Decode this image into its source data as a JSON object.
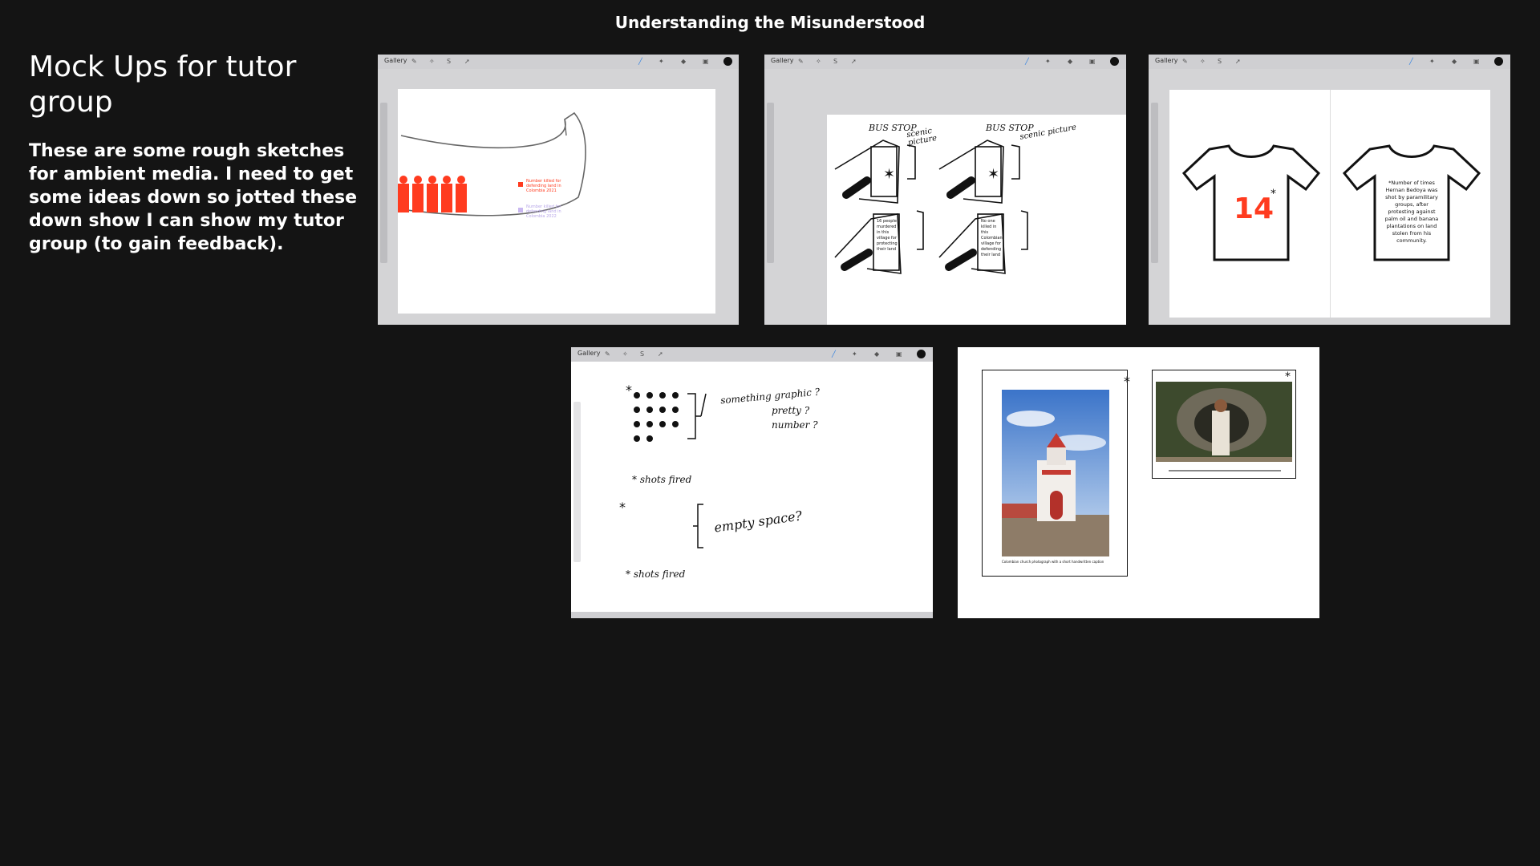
{
  "header": {
    "title": "Understanding the Misunderstood"
  },
  "left": {
    "heading": "Mock Ups for tutor group",
    "description": "These are some rough sketches for ambient media. I need to get some ideas down so jotted these down show I can show my tutor group (to gain feedback)."
  },
  "toolbar": {
    "gallery_label": "Gallery"
  },
  "sketch1": {
    "note_red": "Number killed for defending land in Colombia 2021",
    "note_lilac": "Number killed for defending land in Colombia 2022"
  },
  "sketch2": {
    "bus_stop_1": "BUS STOP",
    "scenic_1": "scenic picture",
    "bus_stop_2": "BUS STOP",
    "scenic_2": "scenic picture",
    "poster_1": "16 people murdered in this village for protecting their land",
    "poster_2": "No one killed in this Colombian village for defending their land"
  },
  "sketch3": {
    "number": "14",
    "asterisk": "*",
    "back_text": "*Number of times Hernan Bedoya was shot by paramilitary groups, after protesting against palm oil and banana plantations on land stolen from his community."
  },
  "sketch4": {
    "asterisk": "*",
    "line1": "something graphic ?",
    "line2": "pretty ?",
    "line3": "number ?",
    "shots1": "* shots fired",
    "empty": "empty space?",
    "shots2": "* shots fired"
  },
  "sketch5": {
    "church_caption": "Colombian church photograph with a short handwritten caption",
    "star": "*"
  },
  "colors": {
    "background": "#141414",
    "accent_red": "#ff3b1f",
    "toolbar": "#cfcfd2"
  }
}
